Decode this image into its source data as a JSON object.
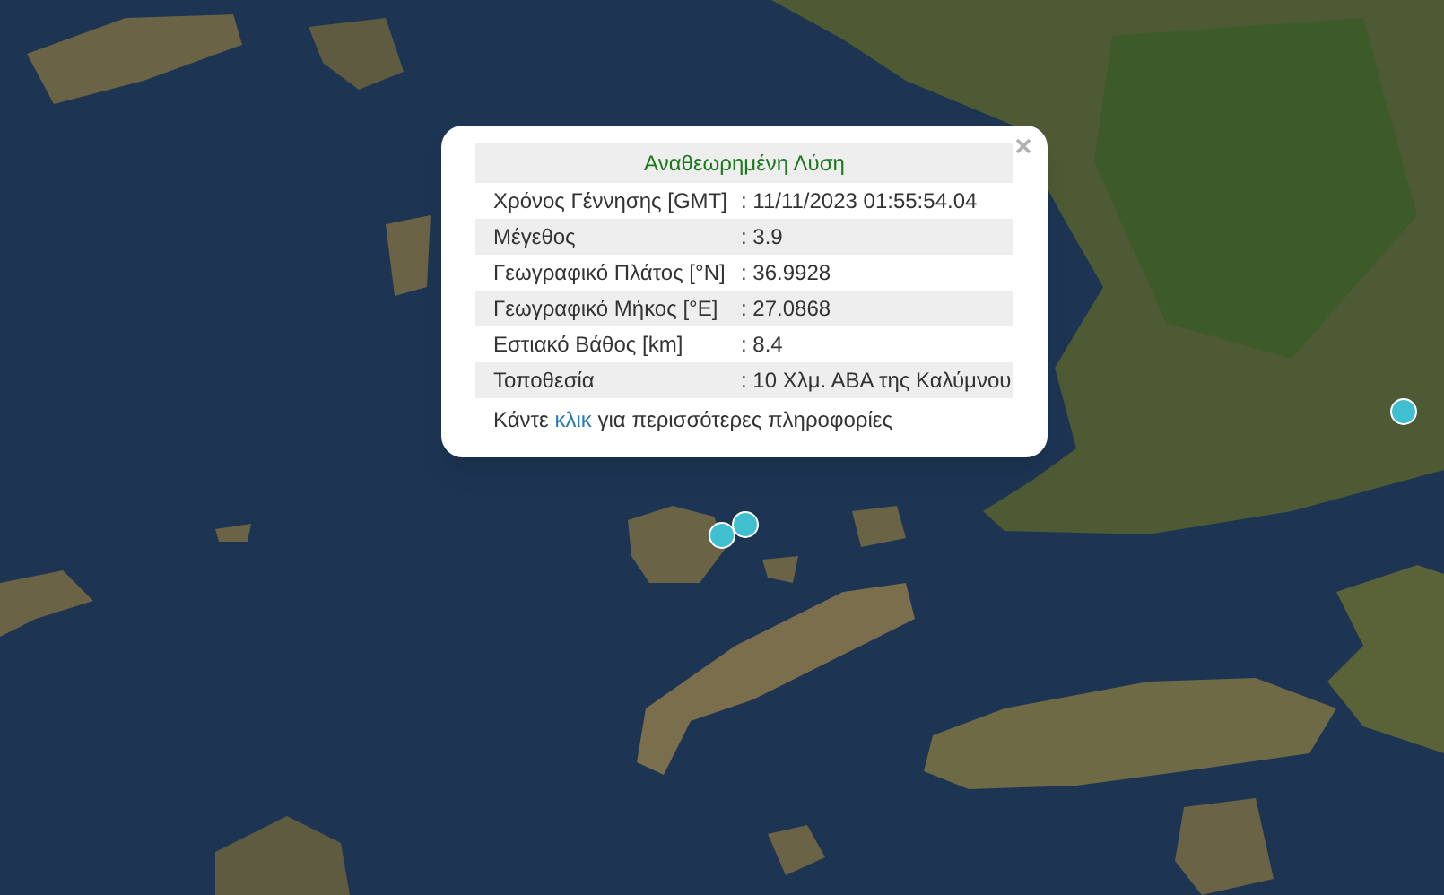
{
  "popup": {
    "title": "Αναθεωρημένη Λύση",
    "rows": [
      {
        "label": "Χρόνος Γέννησης [GMT]",
        "value": ": 11/11/2023 01:55:54.04"
      },
      {
        "label": "Μέγεθος",
        "value": ": 3.9"
      },
      {
        "label": "Γεωγραφικό Πλάτος [°N]",
        "value": ": 36.9928"
      },
      {
        "label": "Γεωγραφικό Μήκος [°E]",
        "value": ": 27.0868"
      },
      {
        "label": "Εστιακό Βάθος [km]",
        "value": ": 8.4"
      },
      {
        "label": "Τοποθεσία",
        "value": ": 10 Χλμ. ΑΒΑ της Καλύμνου"
      }
    ],
    "footer": {
      "before": "Κάντε",
      "link": "κλικ",
      "after": "για περισσότερες πληροφορίες"
    }
  }
}
